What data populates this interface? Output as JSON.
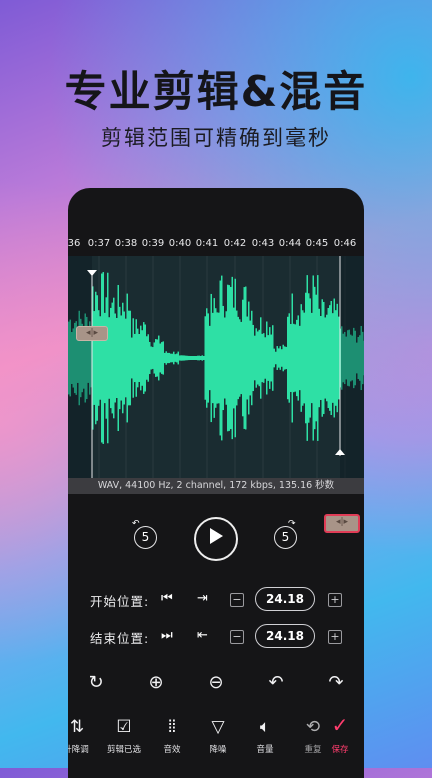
{
  "promo": {
    "title": "专业剪辑&混音",
    "subtitle": "剪辑范围可精确到毫秒"
  },
  "timeline": {
    "ticks": [
      "36",
      "0:37",
      "0:38",
      "0:39",
      "0:40",
      "0:41",
      "0:42",
      "0:43",
      "0:44",
      "0:45",
      "0:46"
    ]
  },
  "waveform": {
    "color": "#2ee0a5",
    "dim_color": "#1d8f72",
    "info": "WAV, 44100 Hz, 2 channel, 172 kbps, 135.16 秒数"
  },
  "playback": {
    "rewind_seconds": "5",
    "forward_seconds": "5"
  },
  "start_row": {
    "label": "开始位置:",
    "value": "24.18",
    "minus": "−",
    "plus": "+"
  },
  "end_row": {
    "label": "结束位置:",
    "value": "24.18",
    "minus": "−",
    "plus": "+"
  },
  "bottom_nav": [
    {
      "label": "升降调",
      "icon": "pitch-icon"
    },
    {
      "label": "剪辑已选",
      "icon": "checkbox-icon"
    },
    {
      "label": "音效",
      "icon": "sound-effect-icon"
    },
    {
      "label": "降噪",
      "icon": "noise-reduction-icon"
    },
    {
      "label": "音量",
      "icon": "volume-icon"
    },
    {
      "label": "重复",
      "icon": "repeat-icon"
    },
    {
      "label": "保存",
      "icon": "check-icon"
    }
  ],
  "colors": {
    "accent": "#ff3d6e",
    "panel": "#151517"
  }
}
